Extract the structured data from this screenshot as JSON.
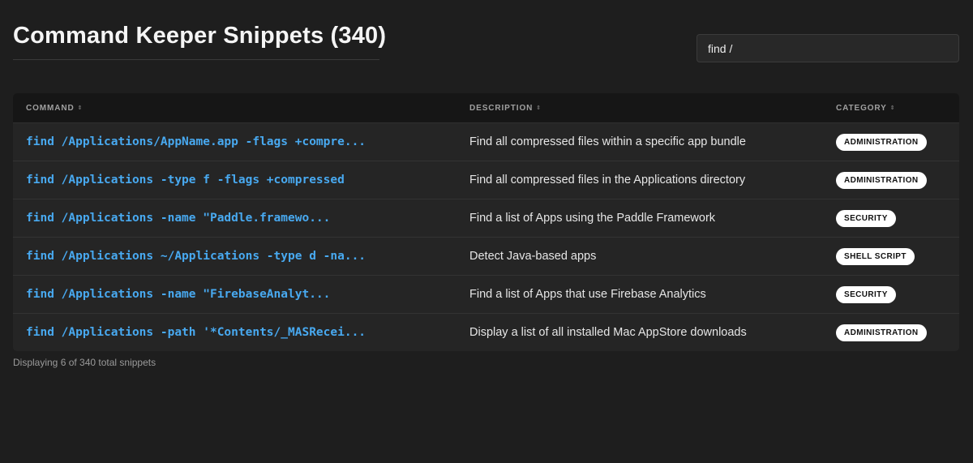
{
  "header": {
    "title": "Command Keeper Snippets (340)"
  },
  "search": {
    "value": "find /"
  },
  "table": {
    "columns": [
      {
        "label": "COMMAND",
        "sort_icon": "⇕"
      },
      {
        "label": "DESCRIPTION",
        "sort_icon": "⇕"
      },
      {
        "label": "CATEGORY",
        "sort_icon": "⇕"
      }
    ],
    "rows": [
      {
        "command": "find /Applications/AppName.app -flags +compre...",
        "description": "Find all compressed files within a specific app bundle",
        "category": "ADMINISTRATION"
      },
      {
        "command": "find /Applications -type f -flags +compressed",
        "description": "Find all compressed files in the Applications directory",
        "category": "ADMINISTRATION"
      },
      {
        "command": "find /Applications -name \"Paddle.framewo...",
        "description": "Find a list of Apps using the Paddle Framework",
        "category": "SECURITY"
      },
      {
        "command": "find /Applications ~/Applications -type d -na...",
        "description": "Detect Java-based apps",
        "category": "SHELL SCRIPT"
      },
      {
        "command": "find /Applications -name \"FirebaseAnalyt...",
        "description": "Find a list of Apps that use Firebase Analytics",
        "category": "SECURITY"
      },
      {
        "command": "find /Applications -path '*Contents/_MASRecei...",
        "description": "Display a list of all installed Mac AppStore downloads",
        "category": "ADMINISTRATION"
      }
    ]
  },
  "footer": {
    "status": "Displaying 6 of 340 total snippets"
  },
  "colors": {
    "background": "#1e1e1e",
    "command_text": "#48a9f0",
    "badge_bg": "#ffffff"
  }
}
